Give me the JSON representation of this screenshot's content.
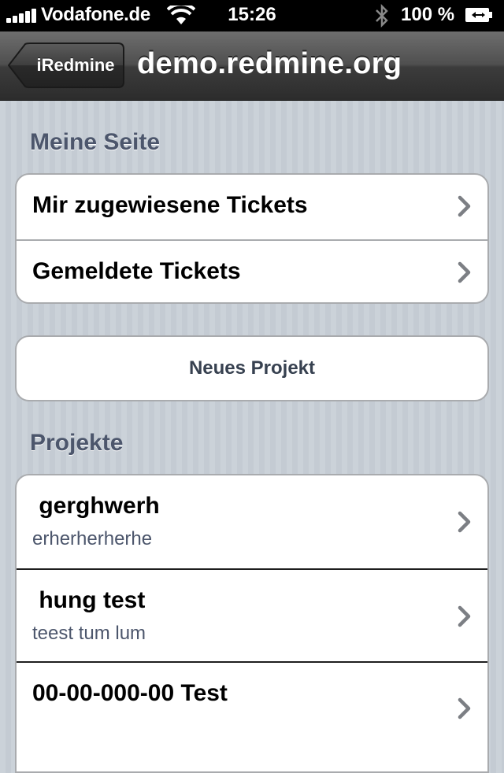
{
  "status_bar": {
    "carrier": "Vodafone.de",
    "time": "15:26",
    "battery_percent": "100 %",
    "icons": [
      "signal-icon",
      "wifi-icon",
      "bluetooth-icon",
      "battery-charging-icon"
    ]
  },
  "nav": {
    "back_label": "iRedmine",
    "title": "demo.redmine.org"
  },
  "my_page": {
    "header": "Meine Seite",
    "rows": [
      {
        "title": "Mir zugewiesene Tickets"
      },
      {
        "title": "Gemeldete Tickets"
      }
    ]
  },
  "new_project_button": "Neues Projekt",
  "projects": {
    "header": "Projekte",
    "items": [
      {
        "title": " gerghwerh",
        "subtitle": "erherherherhe"
      },
      {
        "title": " hung test",
        "subtitle": "teest tum lum"
      },
      {
        "title": "00-00-000-00 Test",
        "subtitle": ""
      }
    ]
  },
  "colors": {
    "section_header": "#4c566c",
    "group_border": "#a9abae",
    "nav_bar_top": "#6e6e6e",
    "nav_bar_bottom": "#2c2c2c"
  }
}
